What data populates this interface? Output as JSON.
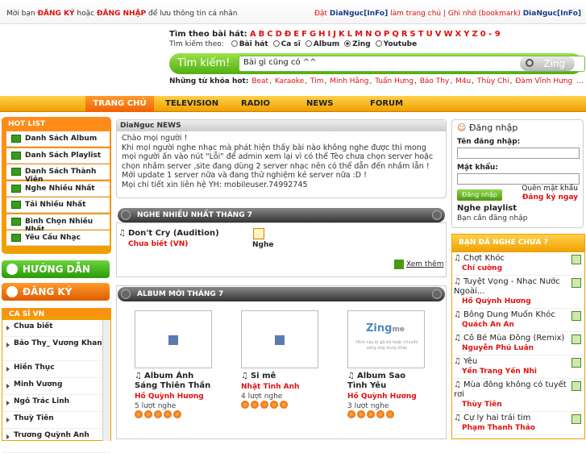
{
  "topbar": {
    "prefix": "Mời bạn",
    "register": "ĐĂNG KÝ",
    "or": "hoặc",
    "login": "ĐĂNG NHẬP",
    "suffix": "để lưu thông tin cá nhân",
    "right_a": "Đặt",
    "right_b": "DiaNguc[InFo]",
    "right_c": "làm trang chủ | Ghi nhớ (bookmark)",
    "right_d": "DiaNguc[InFo]"
  },
  "search": {
    "by_song": "Tìm theo bài hát:",
    "letters": [
      "A",
      "B",
      "C",
      "D",
      "Đ",
      "E",
      "F",
      "G",
      "H",
      "I",
      "J",
      "K",
      "L",
      "M",
      "N",
      "O",
      "P",
      "Q",
      "R",
      "S",
      "T",
      "U",
      "V",
      "W",
      "X",
      "Y",
      "Z",
      "0 - 9"
    ],
    "search_by": "Tìm kiếm theo:",
    "modes": [
      "Bài hát",
      "Ca sĩ",
      "Album",
      "Zing",
      "Youtube"
    ],
    "selected_mode": "Zing",
    "label": "Tìm kiếm!",
    "value": "Bài gì cũng có ^^",
    "button": "Zing",
    "hot_label": "Những từ khóa hot:",
    "hot": [
      "Beat",
      "Karaoke",
      "Tim",
      "Minh Hằng",
      "Tuấn Hưng",
      "Bảo Thy",
      "M4u",
      "Thùy Chi",
      "Đàm Vĩnh Hưng",
      "..."
    ]
  },
  "nav": [
    "TRANG CHỦ",
    "TELEVISION",
    "RADIO",
    "NEWS",
    "FORUM"
  ],
  "hotlist": {
    "title": "HOT LIST",
    "items": [
      "Danh Sách Album",
      "Danh Sách Playlist",
      "Danh Sách Thành Viên",
      "Nghe Nhiều Nhất",
      "Tải Nhiều Nhất",
      "Bình Chọn Nhiều Nhất",
      "Yêu Cầu Nhạc"
    ]
  },
  "guide": "HƯỚNG DẪN",
  "register_btn": "ĐĂNG KÝ",
  "artists": {
    "title": "CA SĨ VN",
    "items": [
      "Chưa biết",
      "Bảo Thy_ Vương Khang",
      "Hiền Thục",
      "Minh Vương",
      "Ngô Trác Linh",
      "Thuỳ Tiên",
      "Trương Quỳnh Anh"
    ]
  },
  "news": {
    "title": "DiaNguc NEWS",
    "lines": [
      "Chào mọi người !",
      "Khi mọi người nghe nhạc mà phát hiện thấy bài nào không nghe được thì mong mọi người ấn vào nút \"Lỗi\" để admin xem lại vì có thể Tèo chưa chọn server hoặc chọn nhầm server ,site đang dùng 2 server nhạc nên có thể dẫn đến nhầm lẫn ! Mới update 1 server nữa và đang thử nghiệm kẻ server nữa :D !",
      "Mọi chi tiết xin liên hệ YH: mobileuser.74992745"
    ]
  },
  "toplisten": {
    "title": "NGHE NHIỀU NHẤT THÁNG 7",
    "song": "Don't Cry (Audition)",
    "artist": "Chưa biết (VN)",
    "play": "Nghe",
    "more": "Xem thêm"
  },
  "albums": {
    "title": "ALBUM MỚI THÁNG 7",
    "items": [
      {
        "title": "Album Ánh Sáng Thiên Thần",
        "artist": "Hồ Quỳnh Hương",
        "count": "5 lượt nghe",
        "rating": 5
      },
      {
        "title": "Si mê",
        "artist": "Nhật Tinh Anh",
        "count": "4 lượt nghe",
        "rating": 5
      },
      {
        "title": "Album Sao Tình Yêu",
        "artist": "Hồ Quỳnh Hương",
        "count": "3 lượt nghe",
        "rating": 5
      }
    ],
    "zing_logo": "Zing",
    "zing_me": "me",
    "zing_caption": "Hình này bị gỡ bỏ hoặc chuyển sang ứng dụng khác"
  },
  "login": {
    "title": "Đăng nhập",
    "user": "Tên đăng nhập:",
    "pass": "Mật khẩu:",
    "button": "Đăng nhập",
    "forgot": "Quên mật khẩu",
    "register": "Đăng ký ngay",
    "playlist": "Nghe playlist",
    "playlist_msg": "Bạn cần đăng nhập"
  },
  "heard": {
    "title": "BẠN ĐÃ NGHE CHƯA ?",
    "items": [
      {
        "t": "Chợt Khóc",
        "a": "Chí cường"
      },
      {
        "t": "Tuyệt Vọng - Nhạc Nước Ngoài...",
        "a": "Hồ Quỳnh Hương"
      },
      {
        "t": "Bông Dung Muốn Khóc",
        "a": "Quách An An"
      },
      {
        "t": "Cô Bé Mùa Đông (Remix)",
        "a": "Nguyễn Phú Luân"
      },
      {
        "t": "Yêu",
        "a": "Yến Trang Yến Nhi"
      },
      {
        "t": "Mùa đông không có tuyết rơi",
        "a": "Thùy Tiên"
      },
      {
        "t": "Cự ly hai trái tim",
        "a": "Phạm Thanh Thảo"
      }
    ]
  }
}
